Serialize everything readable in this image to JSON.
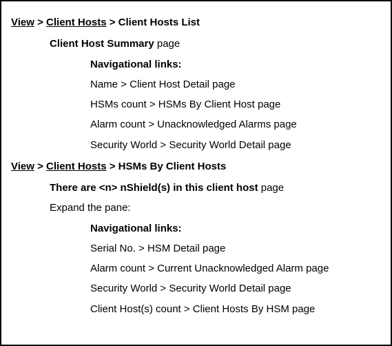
{
  "section1": {
    "breadcrumb": {
      "parts": [
        "View",
        "Client Hosts"
      ],
      "current": "Client Hosts List"
    },
    "summary_label": "Client Host Summary",
    "summary_suffix": " page",
    "nav_heading": "Navigational links:",
    "links": [
      "Name > Client Host Detail page",
      "HSMs count > HSMs By Client Host page",
      "Alarm count > Unacknowledged Alarms page",
      "Security World > Security World Detail page"
    ]
  },
  "section2": {
    "breadcrumb": {
      "parts": [
        "View",
        "Client Hosts"
      ],
      "current": "HSMs By Client Hosts"
    },
    "summary_label": "There are <n> nShield(s) in this client host",
    "summary_suffix": " page",
    "expand_label": "Expand the pane:",
    "nav_heading": "Navigational links:",
    "links": [
      "Serial No. > HSM Detail page",
      "Alarm count > Current Unacknowledged Alarm page",
      "Security World > Security World Detail page",
      "Client Host(s) count > Client Hosts By HSM page"
    ]
  }
}
